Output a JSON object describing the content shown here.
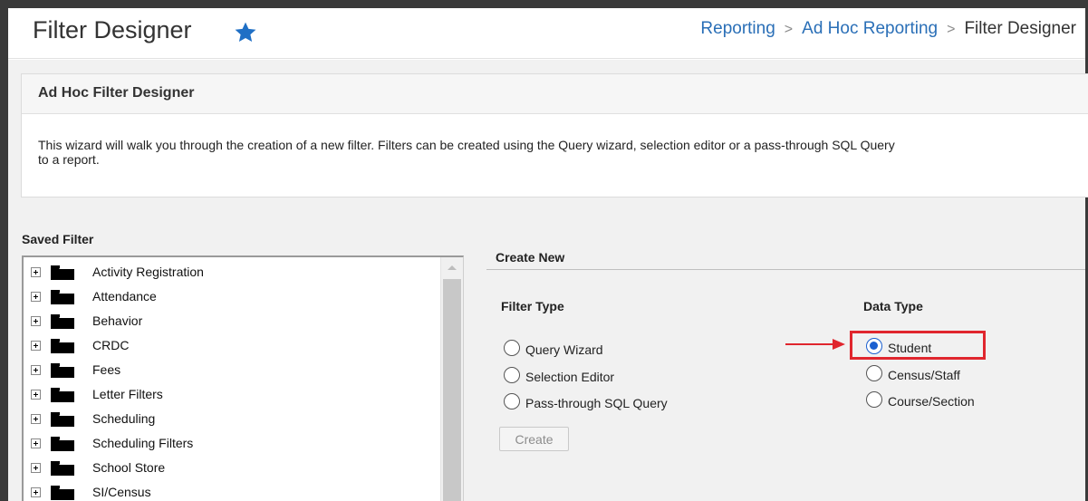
{
  "header": {
    "title": "Filter Designer",
    "breadcrumb": {
      "items": [
        "Reporting",
        "Ad Hoc Reporting"
      ],
      "current": "Filter Designer"
    }
  },
  "panel": {
    "title": "Ad Hoc Filter Designer",
    "description_line1": "This wizard will walk you through the creation of a new filter. Filters can be created using the Query wizard, selection editor or a pass-through SQL Query",
    "description_line2": "to a report."
  },
  "saved_filter": {
    "title": "Saved Filter",
    "items": [
      {
        "label": "Activity Registration"
      },
      {
        "label": "Attendance"
      },
      {
        "label": "Behavior"
      },
      {
        "label": "CRDC"
      },
      {
        "label": "Fees"
      },
      {
        "label": "Letter Filters"
      },
      {
        "label": "Scheduling"
      },
      {
        "label": "Scheduling Filters"
      },
      {
        "label": "School Store"
      },
      {
        "label": "SI/Census"
      }
    ]
  },
  "create_new": {
    "title": "Create New",
    "filter_type": {
      "label": "Filter Type",
      "options": [
        "Query Wizard",
        "Selection Editor",
        "Pass-through SQL Query"
      ]
    },
    "data_type": {
      "label": "Data Type",
      "options": [
        "Student",
        "Census/Staff",
        "Course/Section"
      ],
      "selected": "Student"
    },
    "create_label": "Create"
  },
  "colors": {
    "link": "#2a6fb7",
    "star": "#1f6fc5",
    "annotation": "#e0262e",
    "radio_selected": "#1a5fd0"
  },
  "icons": {
    "favorite": "star-icon",
    "folder": "folder-icon",
    "expand": "plus-box-icon",
    "annotation": "arrow-right-icon"
  }
}
